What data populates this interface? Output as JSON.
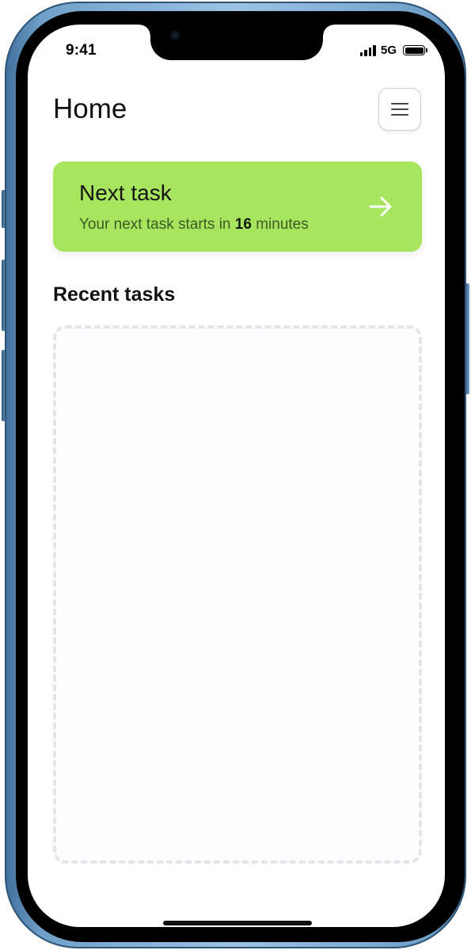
{
  "status_bar": {
    "time": "9:41",
    "network": "5G"
  },
  "header": {
    "title": "Home",
    "menu_icon": "hamburger-menu-icon"
  },
  "next_task_card": {
    "title": "Next task",
    "subtitle_before": "Your next task starts in ",
    "minutes": "16",
    "subtitle_after": " minutes",
    "arrow_icon": "arrow-right-icon",
    "background_color": "#a8e55f"
  },
  "recent_tasks": {
    "title": "Recent tasks"
  },
  "colors": {
    "frame": "#6fa0c9",
    "accent": "#a8e55f"
  }
}
